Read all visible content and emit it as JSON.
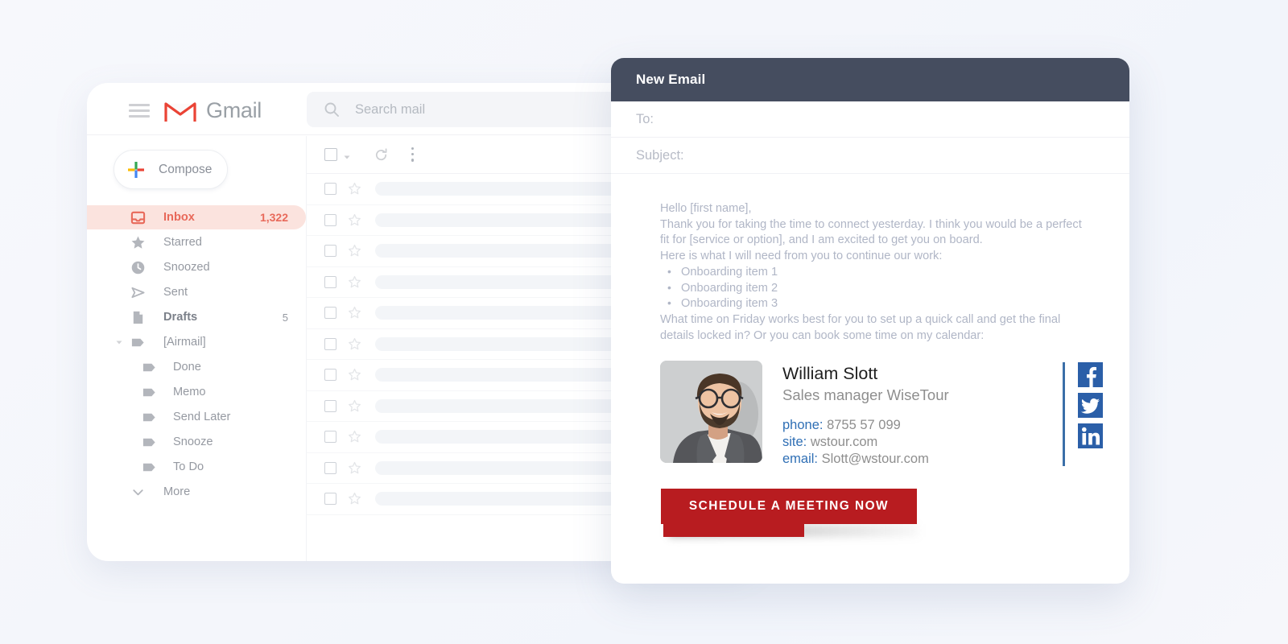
{
  "gmail": {
    "brand": "Gmail",
    "menu_icon": "hamburger-icon",
    "logo_icon": "gmail-logo-icon",
    "search": {
      "icon": "search-icon",
      "placeholder": "Search mail",
      "value": ""
    },
    "compose": {
      "label": "Compose",
      "icon": "plus-icon"
    },
    "nav": [
      {
        "label": "Inbox",
        "count": "1,322",
        "icon": "inbox-icon",
        "active": true,
        "bold": false,
        "nested": false,
        "caret": ""
      },
      {
        "label": "Starred",
        "count": "",
        "icon": "star-icon",
        "active": false,
        "bold": false,
        "nested": false,
        "caret": ""
      },
      {
        "label": "Snoozed",
        "count": "",
        "icon": "clock-icon",
        "active": false,
        "bold": false,
        "nested": false,
        "caret": ""
      },
      {
        "label": "Sent",
        "count": "",
        "icon": "send-icon",
        "active": false,
        "bold": false,
        "nested": false,
        "caret": ""
      },
      {
        "label": "Drafts",
        "count": "5",
        "icon": "draft-icon",
        "active": false,
        "bold": true,
        "nested": false,
        "caret": ""
      },
      {
        "label": "[Airmail]",
        "count": "",
        "icon": "label-icon",
        "active": false,
        "bold": false,
        "nested": false,
        "caret": "caret-down-icon"
      },
      {
        "label": "Done",
        "count": "",
        "icon": "label-icon",
        "active": false,
        "bold": false,
        "nested": true,
        "caret": ""
      },
      {
        "label": "Memo",
        "count": "",
        "icon": "label-icon",
        "active": false,
        "bold": false,
        "nested": true,
        "caret": ""
      },
      {
        "label": "Send Later",
        "count": "",
        "icon": "label-icon",
        "active": false,
        "bold": false,
        "nested": true,
        "caret": ""
      },
      {
        "label": "Snooze",
        "count": "",
        "icon": "label-icon",
        "active": false,
        "bold": false,
        "nested": true,
        "caret": ""
      },
      {
        "label": "To Do",
        "count": "",
        "icon": "label-icon",
        "active": false,
        "bold": false,
        "nested": true,
        "caret": ""
      },
      {
        "label": "More",
        "count": "",
        "icon": "chevron-down-icon",
        "active": false,
        "bold": false,
        "nested": false,
        "caret": ""
      }
    ],
    "list_toolbar": {
      "select_all_icon": "checkbox-icon",
      "select_caret_icon": "caret-down-icon",
      "refresh_icon": "refresh-icon",
      "more_icon": "more-vertical-icon"
    },
    "rows_count": 11
  },
  "compose": {
    "title": "New Email",
    "to_label": "To:",
    "to_value": "",
    "subject_label": "Subject:",
    "subject_value": "",
    "body": {
      "greeting": "Hello [first name],",
      "para1_line1": "Thank you for taking the time to connect yesterday. I think you would be a perfect",
      "para1_line2": "fit for [service or option], and I am excited to get you on board.",
      "para2": "Here is what I will need from you to continue our work:",
      "bullets": [
        "Onboarding item 1",
        "Onboarding item 2",
        "Onboarding item 3"
      ],
      "para3_line1": "What time on Friday works best for you to set up a quick call and get the final",
      "para3_line2": "details locked in? Or you can book some time on my calendar:"
    },
    "signature": {
      "photo_alt": "portrait-photo",
      "name": "William Slott",
      "role": "Sales manager WiseTour",
      "phone_key": "phone:",
      "phone_value": "8755 57 099",
      "site_key": "site:",
      "site_value": "wstour.com",
      "email_key": "email:",
      "email_value": "Slott@wstour.com",
      "social": [
        {
          "name": "facebook-icon",
          "glyph": "f"
        },
        {
          "name": "twitter-icon",
          "glyph": "t"
        },
        {
          "name": "linkedin-icon",
          "glyph": "in"
        }
      ]
    },
    "cta_label": "SCHEDULE A MEETING NOW"
  },
  "colors": {
    "page_background": "#f5f7fb",
    "header_dark": "#454d5f",
    "inbox_accent": "#e8695a",
    "inbox_highlight": "#fbe3de",
    "cta_red": "#b81c20",
    "social_blue": "#2b5fa8",
    "link_blue": "#2f6fb5",
    "body_text": "#b0b6c6"
  }
}
